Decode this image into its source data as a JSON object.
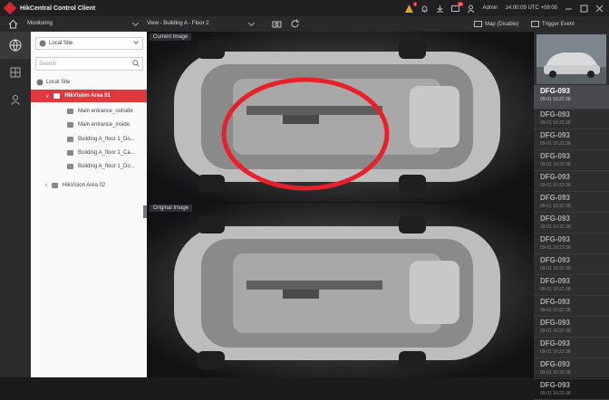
{
  "app": {
    "title": "HikCentral Control Client",
    "user": "Admin",
    "clock": "14:00:09 UTC +08:00",
    "notification_badges": [
      "1",
      "99"
    ]
  },
  "toolbar": {
    "module": "Monitoring",
    "view": "View - Building A - Floor 2",
    "map_label": "Map (Disable)",
    "trigger_label": "Trigger Event"
  },
  "tree": {
    "site": "Local Site",
    "search_placeholder": "Search",
    "root": "Local Site",
    "area1": "HikVision Area 01",
    "cameras": [
      "Main entrance_outside",
      "Main entrance_inside",
      "Building A_floor 1_Do...",
      "Building A_floor 1_Ca...",
      "Building A_floor 1_Do..."
    ],
    "area2": "HikVision Area 02"
  },
  "panes": {
    "current": "Current Image",
    "original": "Original Image"
  },
  "captures": [
    {
      "plate": "DFG-093",
      "time": "09-01 16:22:38"
    },
    {
      "plate": "DFG-093",
      "time": "09-01 16:22:38"
    },
    {
      "plate": "DFG-093",
      "time": "09-01 16:22:38"
    },
    {
      "plate": "DFG-093",
      "time": "09-01 16:22:38"
    },
    {
      "plate": "DFG-093",
      "time": "09-01 16:22:38"
    },
    {
      "plate": "DFG-093",
      "time": "09-01 16:22:38"
    },
    {
      "plate": "DFG-093",
      "time": "09-01 16:22:38"
    },
    {
      "plate": "DFG-093",
      "time": "09-01 16:22:38"
    },
    {
      "plate": "DFG-093",
      "time": "09-01 16:22:38"
    },
    {
      "plate": "DFG-093",
      "time": "09-01 16:22:38"
    },
    {
      "plate": "DFG-093",
      "time": "09-01 16:22:38"
    },
    {
      "plate": "DFG-093",
      "time": "09-01 16:22:38"
    },
    {
      "plate": "DFG-093",
      "time": "09-01 16:22:38"
    },
    {
      "plate": "DFG-093",
      "time": "09-01 16:22:38"
    },
    {
      "plate": "DFG-093",
      "time": "09-01 16:22:38"
    }
  ],
  "colors": {
    "accent": "#e0383f",
    "highlight_circle": "#e8202a"
  },
  "icons": [
    "hik-logo-icon",
    "home-icon",
    "alarm-icon",
    "bell-icon",
    "download-icon",
    "message-icon",
    "user-icon",
    "minimize-icon",
    "maximize-icon",
    "close-icon",
    "globe-icon",
    "grid-icon",
    "person-icon",
    "search-icon",
    "refresh-icon",
    "camera-icon"
  ]
}
